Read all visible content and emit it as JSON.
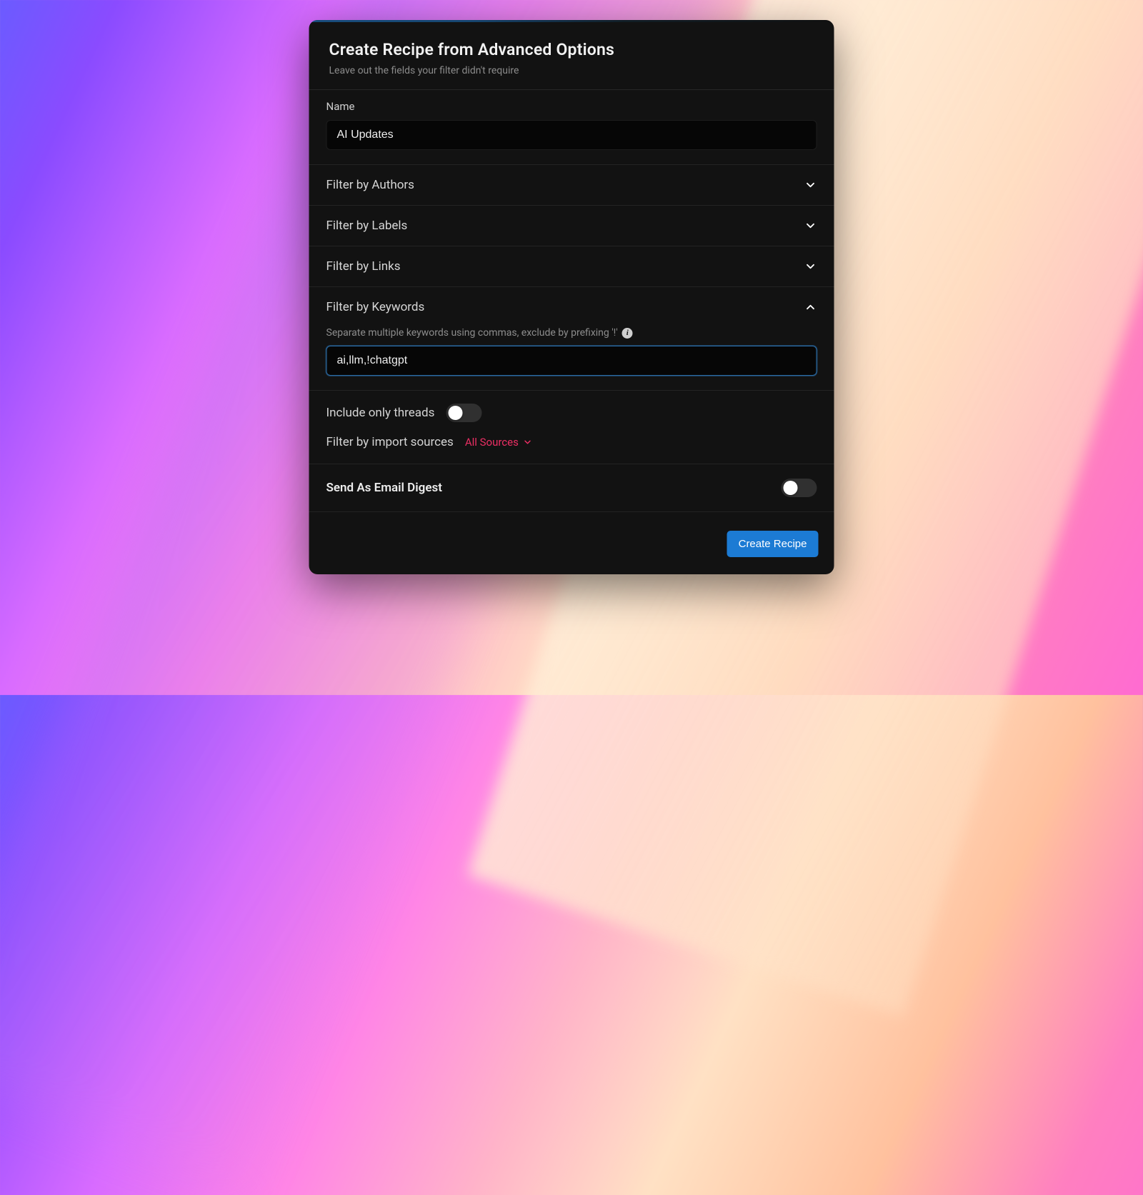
{
  "header": {
    "title": "Create Recipe from Advanced Options",
    "subtitle": "Leave out the fields your filter didn't require"
  },
  "name": {
    "label": "Name",
    "value": "AI Updates"
  },
  "accordions": {
    "authors": "Filter by Authors",
    "labels": "Filter by Labels",
    "links": "Filter by Links",
    "keywords": "Filter by Keywords"
  },
  "keywords": {
    "hint": "Separate multiple keywords using commas, exclude by prefixing '!'",
    "value": "ai,llm,!chatgpt"
  },
  "options": {
    "threads_label": "Include only threads",
    "threads_on": false,
    "sources_label": "Filter by import sources",
    "sources_value": "All Sources"
  },
  "digest": {
    "label": "Send As Email Digest",
    "on": false
  },
  "footer": {
    "submit": "Create Recipe"
  }
}
